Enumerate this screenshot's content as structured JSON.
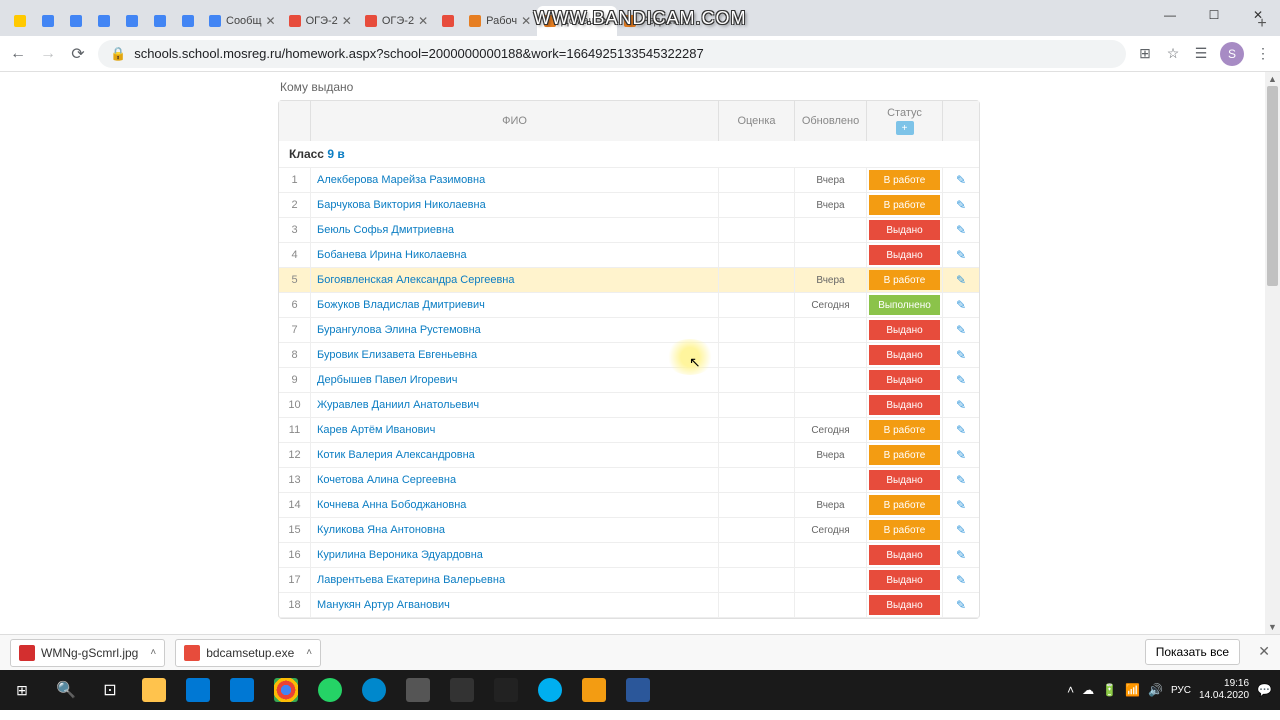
{
  "watermark": "WWW.BANDICAM.COM",
  "tabs": [
    {
      "text": "",
      "color": "#ffc900"
    },
    {
      "text": "",
      "color": "#4285f4"
    },
    {
      "text": "",
      "color": "#4285f4"
    },
    {
      "text": "",
      "color": "#4285f4"
    },
    {
      "text": "",
      "color": "#4285f4"
    },
    {
      "text": "",
      "color": "#4285f4"
    },
    {
      "text": "",
      "color": "#4285f4"
    },
    {
      "text": "Сообщ",
      "color": "#4285f4"
    },
    {
      "text": "ОГЭ-2",
      "color": "#e74c3c"
    },
    {
      "text": "ОГЭ-2",
      "color": "#e74c3c"
    },
    {
      "text": "",
      "color": "#e74c3c"
    },
    {
      "text": "Рабоч",
      "color": "#e67e22"
    },
    {
      "text": "Домаш",
      "color": "#e67e22"
    },
    {
      "text": "Редакт",
      "color": "#e67e22"
    }
  ],
  "active_tab": 12,
  "url": "schools.school.mosreg.ru/homework.aspx?school=2000000000188&work=1664925133545322287",
  "avatar_letter": "S",
  "section_label": "Кому выдано",
  "headers": {
    "fio": "ФИО",
    "grade": "Оценка",
    "updated": "Обновлено",
    "status": "Статус"
  },
  "class_label": "Класс",
  "class_name": "9 в",
  "status_labels": {
    "work": "В работе",
    "issued": "Выдано",
    "done": "Выполнено"
  },
  "rows": [
    {
      "n": 1,
      "name": "Алекберова Марейза Разимовна",
      "upd": "Вчера",
      "status": "work"
    },
    {
      "n": 2,
      "name": "Барчукова Виктория Николаевна",
      "upd": "Вчера",
      "status": "work"
    },
    {
      "n": 3,
      "name": "Беюль Софья Дмитриевна",
      "upd": "",
      "status": "issued"
    },
    {
      "n": 4,
      "name": "Бобанева Ирина Николаевна",
      "upd": "",
      "status": "issued"
    },
    {
      "n": 5,
      "name": "Богоявленская Александра Сергеевна",
      "upd": "Вчера",
      "status": "work",
      "hl": true
    },
    {
      "n": 6,
      "name": "Божуков Владислав Дмитриевич",
      "upd": "Сегодня",
      "status": "done"
    },
    {
      "n": 7,
      "name": "Бурангулова Элина Рустемовна",
      "upd": "",
      "status": "issued"
    },
    {
      "n": 8,
      "name": "Буровик Елизавета Евгеньевна",
      "upd": "",
      "status": "issued"
    },
    {
      "n": 9,
      "name": "Дербышев Павел Игоревич",
      "upd": "",
      "status": "issued"
    },
    {
      "n": 10,
      "name": "Журавлев Даниил Анатольевич",
      "upd": "",
      "status": "issued"
    },
    {
      "n": 11,
      "name": "Карев Артём Иванович",
      "upd": "Сегодня",
      "status": "work"
    },
    {
      "n": 12,
      "name": "Котик Валерия Александровна",
      "upd": "Вчера",
      "status": "work"
    },
    {
      "n": 13,
      "name": "Кочетова Алина Сергеевна",
      "upd": "",
      "status": "issued"
    },
    {
      "n": 14,
      "name": "Кочнева Анна Бободжановна",
      "upd": "Вчера",
      "status": "work"
    },
    {
      "n": 15,
      "name": "Куликова Яна Антоновна",
      "upd": "Сегодня",
      "status": "work"
    },
    {
      "n": 16,
      "name": "Курилина Вероника Эдуардовна",
      "upd": "",
      "status": "issued"
    },
    {
      "n": 17,
      "name": "Лаврентьева Екатерина Валерьевна",
      "upd": "",
      "status": "issued"
    },
    {
      "n": 18,
      "name": "Манукян Артур Агванович",
      "upd": "",
      "status": "issued"
    }
  ],
  "downloads": [
    {
      "name": "WMNg-gScmrl.jpg",
      "icon": "#d32f2f"
    },
    {
      "name": "bdcamsetup.exe",
      "icon": "#e74c3c"
    }
  ],
  "showall": "Показать все",
  "tray": {
    "lang": "РУС",
    "time": "19:16",
    "date": "14.04.2020"
  }
}
